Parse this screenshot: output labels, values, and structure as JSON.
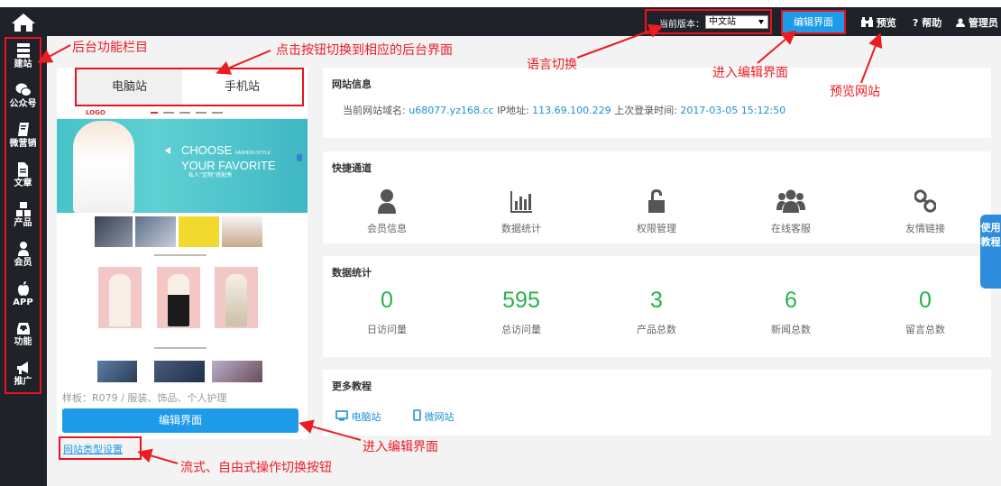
{
  "topbar": {
    "home_icon": "home-icon",
    "lang_label": "当前版本：",
    "lang_value": "中文站",
    "edit_button": "编辑界面",
    "preview_label": "预览",
    "help_label": "帮助",
    "admin_label": "管理员"
  },
  "sidebar": {
    "items": [
      {
        "label": "建站",
        "icon": "server-icon"
      },
      {
        "label": "公众号",
        "icon": "wechat-icon"
      },
      {
        "label": "微营销",
        "icon": "book-icon"
      },
      {
        "label": "文章",
        "icon": "document-icon"
      },
      {
        "label": "产品",
        "icon": "cubes-icon"
      },
      {
        "label": "会员",
        "icon": "user-icon"
      },
      {
        "label": "APP",
        "icon": "apple-icon"
      },
      {
        "label": "功能",
        "icon": "inbox-icon"
      },
      {
        "label": "推广",
        "icon": "bullhorn-icon"
      }
    ]
  },
  "preview": {
    "tab_pc": "电脑站",
    "tab_mobile": "手机站",
    "template_text": "样板：R079 / 服装、饰品、个人护理",
    "edit_button": "编辑界面",
    "site_type_link": "网站类型设置",
    "mock": {
      "logo": "LOGO",
      "hero_title_1": "CHOOSE",
      "hero_title_2": "YOUR FAVORITE",
      "hero_small": "FASHION STYLE",
      "hero_cn": "私人“定制”搭配秀"
    }
  },
  "site_info": {
    "title": "网站信息",
    "domain_label": "当前网站域名:",
    "domain_value": "u68077.yz168.cc",
    "ip_label": "IP地址:",
    "ip_value": "113.69.100.229",
    "login_label": "上次登录时间:",
    "login_value": "2017-03-05 15:12:50"
  },
  "quick": {
    "title": "快捷通道",
    "items": [
      {
        "label": "会员信息",
        "icon": "user-icon"
      },
      {
        "label": "数据统计",
        "icon": "bar-chart-icon"
      },
      {
        "label": "权限管理",
        "icon": "unlock-icon"
      },
      {
        "label": "在线客服",
        "icon": "users-icon"
      },
      {
        "label": "友情链接",
        "icon": "link-icon"
      }
    ]
  },
  "stats": {
    "title": "数据统计",
    "items": [
      {
        "value": "0",
        "label": "日访问量"
      },
      {
        "value": "595",
        "label": "总访问量"
      },
      {
        "value": "3",
        "label": "产品总数"
      },
      {
        "value": "6",
        "label": "新闻总数"
      },
      {
        "value": "0",
        "label": "留言总数"
      }
    ]
  },
  "tutorials": {
    "title": "更多教程",
    "pc_link": "电脑站",
    "mobile_link": "微网站"
  },
  "help_tab": "使用教程",
  "annotations": {
    "sidebar": "后台功能栏目",
    "tabs": "点击按钮切换到相应的后台界面",
    "language": "语言切换",
    "enter_edit_top": "进入编辑界面",
    "preview_site": "预览网站",
    "enter_edit_bottom": "进入编辑界面",
    "mode_switch": "流式、自由式操作切换按钮"
  },
  "colors": {
    "dark": "#20222a",
    "accent_blue": "#1e9be8",
    "stat_green": "#27b24a",
    "annotation_red": "#ec1c24"
  }
}
